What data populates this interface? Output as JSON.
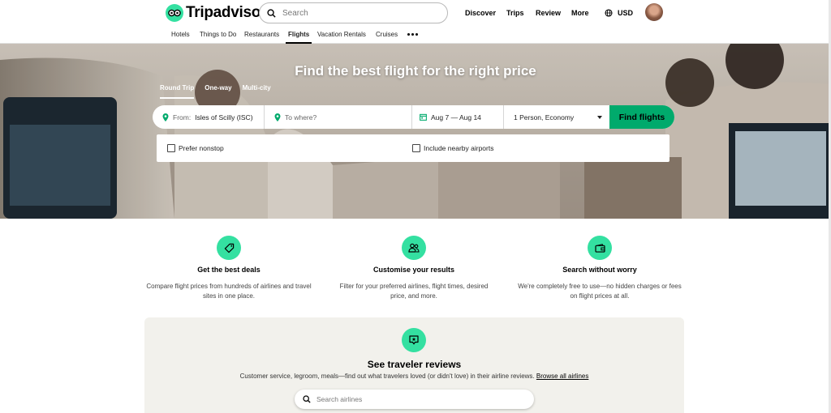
{
  "brand": {
    "name": "Tripadvisor",
    "color": "#34e0a1",
    "cta_color": "#00aa6c"
  },
  "header": {
    "search_placeholder": "Search",
    "nav": [
      "Discover",
      "Trips",
      "Review",
      "More"
    ],
    "currency": "USD",
    "icons": {
      "search": "search-icon",
      "globe": "globe-icon",
      "avatar": "user-avatar"
    }
  },
  "categories": {
    "items": [
      "Hotels",
      "Things to Do",
      "Restaurants",
      "Flights",
      "Vacation Rentals",
      "Cruises"
    ],
    "active": "Flights",
    "more_icon": "more-dots-icon"
  },
  "hero": {
    "title": "Find the best flight for the right price",
    "trip_types": [
      "Round Trip",
      "One-way",
      "Multi-city"
    ],
    "active_trip_type": "Round Trip",
    "from_label": "From:",
    "from_value": "Isles of Scilly (ISC)",
    "to_placeholder": "To where?",
    "dates": "Aug 7 — Aug 14",
    "travelers": "1 Person, Economy",
    "search_button": "Find flights",
    "options": [
      "Prefer nonstop",
      "Include nearby airports"
    ]
  },
  "features": [
    {
      "icon": "tag-icon",
      "title": "Get the best deals",
      "description": "Compare flight prices from hundreds of airlines and travel sites in one place."
    },
    {
      "icon": "people-icon",
      "title": "Customise your results",
      "description": "Filter for your preferred airlines, flight times, desired price, and more."
    },
    {
      "icon": "wallet-icon",
      "title": "Search without worry",
      "description": "We're completely free to use—no hidden charges or fees on flight prices at all."
    }
  ],
  "reviews": {
    "icon": "review-bubble-icon",
    "title": "See traveler reviews",
    "subtitle": "Customer service, legroom, meals—find out what travelers loved (or didn't love) in their airline reviews.",
    "link": "Browse all airlines",
    "search_placeholder": "Search airlines"
  }
}
